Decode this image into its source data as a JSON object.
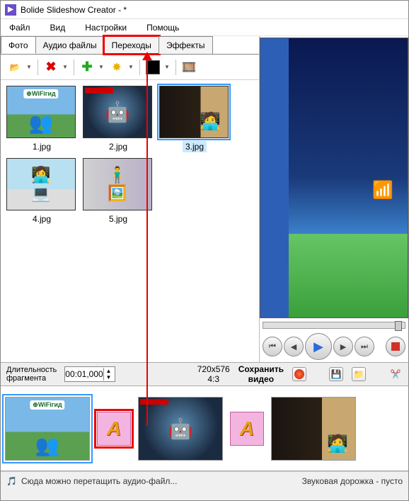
{
  "window": {
    "title": "Bolide Slideshow Creator - *"
  },
  "menu": {
    "file": "Файл",
    "view": "Вид",
    "settings": "Настройки",
    "help": "Помощь"
  },
  "tabs": {
    "photo": "Фото",
    "audio": "Аудио файлы",
    "transitions": "Переходы",
    "effects": "Эффекты"
  },
  "thumbs": [
    {
      "name": "1.jpg"
    },
    {
      "name": "2.jpg"
    },
    {
      "name": "3.jpg"
    },
    {
      "name": "4.jpg"
    },
    {
      "name": "5.jpg"
    }
  ],
  "fragment": {
    "label": "Длительность фрагмента",
    "value": "00:01,000"
  },
  "dims": {
    "res": "720x576",
    "ratio": "4:3"
  },
  "save": {
    "line1": "Сохранить",
    "line2": "видео"
  },
  "audio": {
    "hint": "Сюда можно перетащить аудио-файл...",
    "empty": "Звуковая дорожка - пусто"
  }
}
